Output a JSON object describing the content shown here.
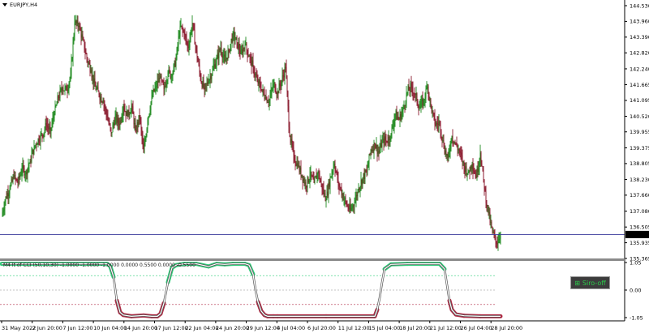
{
  "window": {
    "symbol_label": "EURJPY,H4",
    "menu_icon": "triangle-down-icon"
  },
  "colors": {
    "bull": "#1f8a1f",
    "bear": "#8b1a2e",
    "bid_line": "#3b3b9c",
    "high_line": "#2fce7a",
    "low_line": "#b02a44",
    "mid_line": "#888888"
  },
  "chart_data": [
    {
      "type": "candlestick",
      "price_axis_labels": [
        "144.530",
        "143.960",
        "143.390",
        "142.820",
        "142.240",
        "141.665",
        "141.095",
        "140.520",
        "139.955",
        "139.375",
        "138.805",
        "138.230",
        "137.660",
        "137.080",
        "136.505",
        "135.935",
        "135.365"
      ],
      "ylim": [
        135.365,
        144.53
      ],
      "current_price": "136.234",
      "bid_line": 136.234,
      "close_path": [
        [
          0,
          136.9
        ],
        [
          5,
          137.6
        ],
        [
          10,
          137.9
        ],
        [
          15,
          138.3
        ],
        [
          20,
          138.1
        ],
        [
          25,
          138.6
        ],
        [
          30,
          138.5
        ],
        [
          35,
          138.9
        ],
        [
          40,
          139.4
        ],
        [
          45,
          139.7
        ],
        [
          50,
          139.85
        ],
        [
          55,
          140.2
        ],
        [
          60,
          140.0
        ],
        [
          65,
          140.6
        ],
        [
          70,
          141.2
        ],
        [
          75,
          141.55
        ],
        [
          80,
          141.45
        ],
        [
          85,
          142.0
        ],
        [
          90,
          143.9
        ],
        [
          95,
          143.8
        ],
        [
          100,
          143.3
        ],
        [
          105,
          142.6
        ],
        [
          110,
          142.2
        ],
        [
          115,
          141.6
        ],
        [
          120,
          141.3
        ],
        [
          125,
          141.1
        ],
        [
          130,
          140.5
        ],
        [
          135,
          139.9
        ],
        [
          140,
          140.5
        ],
        [
          145,
          140.2
        ],
        [
          150,
          140.9
        ],
        [
          155,
          140.5
        ],
        [
          160,
          140.9
        ],
        [
          165,
          140.0
        ],
        [
          170,
          140.5
        ],
        [
          175,
          139.2
        ],
        [
          180,
          140.4
        ],
        [
          185,
          141.2
        ],
        [
          190,
          141.6
        ],
        [
          195,
          141.9
        ],
        [
          200,
          141.5
        ],
        [
          205,
          142.1
        ],
        [
          210,
          142.0
        ],
        [
          215,
          142.6
        ],
        [
          220,
          143.8
        ],
        [
          225,
          143.5
        ],
        [
          230,
          143.0
        ],
        [
          235,
          143.9
        ],
        [
          240,
          142.9
        ],
        [
          245,
          141.9
        ],
        [
          250,
          141.5
        ],
        [
          255,
          141.8
        ],
        [
          260,
          142.2
        ],
        [
          265,
          142.6
        ],
        [
          270,
          143.0
        ],
        [
          275,
          142.5
        ],
        [
          280,
          142.9
        ],
        [
          285,
          143.5
        ],
        [
          290,
          143.2
        ],
        [
          295,
          142.8
        ],
        [
          300,
          143.1
        ],
        [
          305,
          142.7
        ],
        [
          310,
          142.3
        ],
        [
          315,
          141.8
        ],
        [
          320,
          141.5
        ],
        [
          325,
          141.2
        ],
        [
          330,
          141.1
        ],
        [
          335,
          141.7
        ],
        [
          340,
          141.4
        ],
        [
          345,
          141.8
        ],
        [
          350,
          142.3
        ],
        [
          355,
          139.8
        ],
        [
          360,
          139.1
        ],
        [
          365,
          138.7
        ],
        [
          370,
          138.4
        ],
        [
          375,
          138.0
        ],
        [
          380,
          138.4
        ],
        [
          385,
          138.1
        ],
        [
          390,
          138.5
        ],
        [
          395,
          137.9
        ],
        [
          400,
          137.5
        ],
        [
          405,
          138.3
        ],
        [
          410,
          138.8
        ],
        [
          415,
          138.1
        ],
        [
          420,
          137.7
        ],
        [
          425,
          137.3
        ],
        [
          430,
          137.1
        ],
        [
          435,
          137.4
        ],
        [
          440,
          137.9
        ],
        [
          445,
          138.3
        ],
        [
          450,
          138.5
        ],
        [
          455,
          139.3
        ],
        [
          460,
          139.5
        ],
        [
          465,
          139.2
        ],
        [
          470,
          139.7
        ],
        [
          475,
          139.6
        ],
        [
          480,
          139.9
        ],
        [
          485,
          140.6
        ],
        [
          490,
          140.4
        ],
        [
          495,
          140.8
        ],
        [
          500,
          141.4
        ],
        [
          505,
          141.6
        ],
        [
          510,
          141.3
        ],
        [
          515,
          140.8
        ],
        [
          520,
          141.1
        ],
        [
          525,
          141.6
        ],
        [
          530,
          140.7
        ],
        [
          535,
          140.2
        ],
        [
          540,
          140.3
        ],
        [
          545,
          139.4
        ],
        [
          550,
          139.0
        ],
        [
          555,
          139.8
        ],
        [
          560,
          139.5
        ],
        [
          565,
          139.2
        ],
        [
          570,
          138.7
        ],
        [
          575,
          138.5
        ],
        [
          580,
          138.8
        ],
        [
          585,
          138.3
        ],
        [
          590,
          139.2
        ],
        [
          595,
          137.9
        ],
        [
          600,
          137.0
        ],
        [
          605,
          136.3
        ],
        [
          610,
          135.9
        ],
        [
          615,
          136.25
        ]
      ]
    },
    {
      "type": "line",
      "title": "M4 lt of CCI (50,10,30) -1.0000 -1.0000 -1.0000 0.0000 0.5500 0.0000 -0.5500",
      "ylim": [
        -1.05,
        1.05
      ],
      "axis_labels": [
        "1.05",
        "0.00",
        "-1.05"
      ],
      "levels": [
        0.55,
        0.0,
        -0.55
      ],
      "x": [
        0,
        120,
        130,
        134,
        138,
        142,
        146,
        150,
        160,
        175,
        185,
        192,
        196,
        200,
        205,
        210,
        215,
        225,
        240,
        255,
        265,
        275,
        285,
        300,
        305,
        310,
        313,
        316,
        320,
        324,
        328,
        335,
        340,
        400,
        460,
        463,
        466,
        469,
        472,
        480,
        500,
        540,
        546,
        549,
        552,
        555,
        560,
        570,
        590,
        615
      ],
      "values": [
        1.0,
        1.0,
        1.0,
        0.9,
        0.5,
        -0.4,
        -0.85,
        -0.95,
        -1.0,
        -0.97,
        -1.0,
        -1.0,
        -0.9,
        -0.5,
        0.3,
        0.85,
        0.95,
        1.0,
        1.0,
        0.9,
        1.0,
        0.98,
        1.0,
        1.0,
        0.95,
        0.6,
        0.0,
        -0.45,
        -0.8,
        -0.95,
        -1.0,
        -1.0,
        -1.0,
        -1.0,
        -1.0,
        -0.75,
        -0.3,
        0.3,
        0.8,
        0.98,
        1.0,
        1.0,
        0.8,
        0.2,
        -0.4,
        -0.75,
        -0.93,
        -0.98,
        -1.0,
        -1.0
      ]
    }
  ],
  "time_axis": [
    "31 May 2022",
    "2 Jun 20:00",
    "7 Jun 12:00",
    "10 Jun 04:00",
    "14 Jun 20:00",
    "17 Jun 12:00",
    "22 Jun 04:00",
    "24 Jun 20:00",
    "29 Jun 12:00",
    "4 Jul 04:00",
    "6 Jul 20:00",
    "11 Jul 12:00",
    "15 Jul 04:00",
    "18 Jul 20:00",
    "21 Jul 12:00",
    "26 Jul 04:00",
    "28 Jul 20:00"
  ],
  "siro_button": {
    "label": "Siro-off",
    "icon": "grid-icon"
  }
}
